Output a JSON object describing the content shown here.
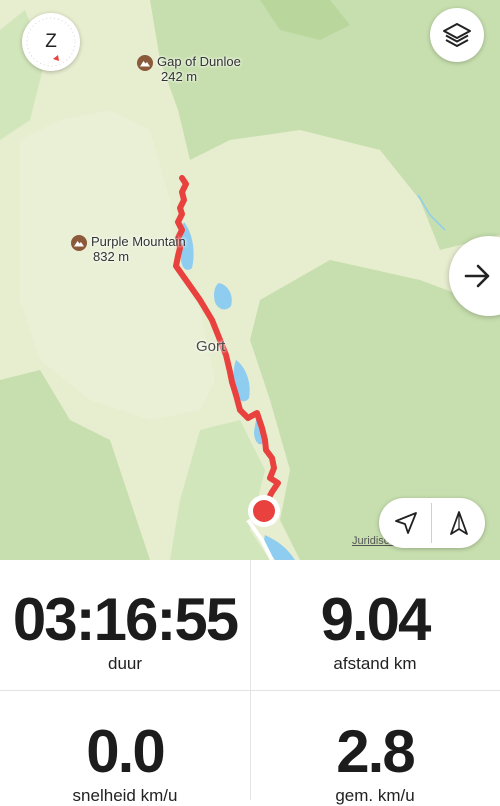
{
  "map": {
    "compass_letter": "Z",
    "pois": [
      {
        "name": "Gap of Dunloe",
        "elevation": "242 m",
        "icon": "mountain-pass-icon"
      },
      {
        "name": "Purple Mountain",
        "elevation": "832 m",
        "icon": "mountain-peak-icon"
      }
    ],
    "place_label": "Gort",
    "legal_link": "Juridische info",
    "route_color": "#e8413e",
    "location_color": "#e8413e",
    "water_color": "#8fcdf0",
    "forest_color": "#c7dfae",
    "icons": {
      "compass": "compass-icon",
      "layers": "layers-icon",
      "next": "arrow-right-icon",
      "locate": "location-arrow-icon",
      "heading": "north-heading-icon"
    }
  },
  "stats": {
    "duration": {
      "value": "03:16:55",
      "label": "duur"
    },
    "distance": {
      "value": "9.04",
      "label": "afstand km"
    },
    "speed": {
      "value": "0.0",
      "label": "snelheid km/u"
    },
    "avg_speed": {
      "value": "2.8",
      "label": "gem. km/u"
    }
  }
}
